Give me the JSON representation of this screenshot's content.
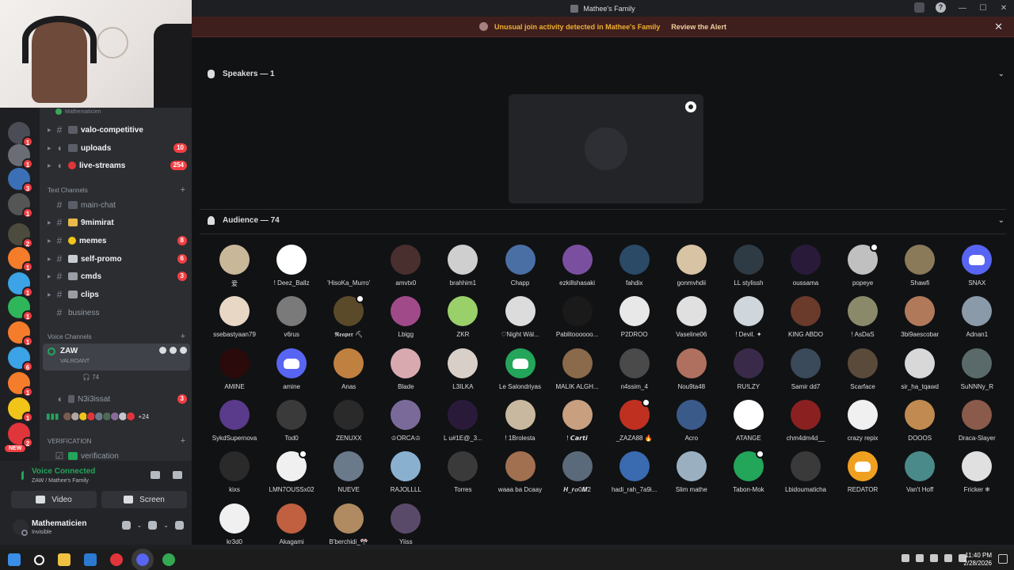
{
  "window": {
    "title": "Mathee's Family"
  },
  "alert": {
    "text": "Unusual join activity detected in Mathee's Family",
    "action": "Review the Alert"
  },
  "channel_top_label": "Mathematicien",
  "channels": [
    {
      "name": "valo-competitive",
      "count": "",
      "unread": true
    },
    {
      "name": "uploads",
      "count": "10",
      "unread": true
    },
    {
      "name": "live-streams",
      "count": "254",
      "unread": true
    }
  ],
  "text_category": "Text Channels",
  "text_channels": [
    {
      "name": "main-chat",
      "count": "",
      "unread": false
    },
    {
      "name": "9mimirat",
      "count": "",
      "unread": true
    },
    {
      "name": "memes",
      "count": "8",
      "unread": true
    },
    {
      "name": "self-promo",
      "count": "6",
      "unread": true
    },
    {
      "name": "cmds",
      "count": "3",
      "unread": true
    },
    {
      "name": "clips",
      "count": "",
      "unread": true
    },
    {
      "name": "business",
      "count": "",
      "unread": false
    }
  ],
  "voice_category": "Voice Channels",
  "active_voice": {
    "name": "ZAW",
    "sub": "VALROANT",
    "listeners": "74"
  },
  "n3i3issat": {
    "name": "N3i3issat",
    "count": "3"
  },
  "voice_avatars_more": "+24",
  "verification_category": "VERIFICATION",
  "verification_channel": "verification",
  "voice_panel": {
    "title": "Voice Connected",
    "sub": "ZAW / Mathee's Family",
    "video": "Video",
    "screen": "Screen"
  },
  "user": {
    "name": "Mathematicien",
    "status": "Invisible"
  },
  "speakers": {
    "label": "Speakers — 1"
  },
  "audience": {
    "label": "Audience — 74"
  },
  "audience_members": [
    "爱",
    "! Deez_Ballz",
    "'HisoKa_Murro'",
    "amvtx0",
    "brahhim1",
    "Chapp",
    "ezkillshasaki",
    "fahdix",
    "gonmvhdii",
    "LL stylissh",
    "oussama",
    "popeye",
    "Shawfi",
    "SNAX",
    "ssebastyaan79",
    "v6rus",
    "𝕽𝖊𝖆𝖕𝖊𝖗 ⛏",
    "Lbigg",
    "ZKR",
    "♡Night Wäl...",
    "Pablitoooooo...",
    "P2DROO",
    "Vaseline06",
    "! Devil. ✦",
    "KING ABDO",
    "! AsDaS",
    "3bi9aescobar",
    "Adnan1",
    "AMINE",
    "amine",
    "Anas",
    "Blade",
    "L3ILKA",
    "Le Salondriyas",
    "MALIK ALGH...",
    "n4ssim_4",
    "Nou9ta48",
    "RU!LZY",
    "Samir dd7",
    "Scarface",
    "sir_ha_tqawd",
    "SuNNNy_R",
    "SykdSupernova",
    "Tod0",
    "ZENUXX",
    "♔ORCA♔",
    "L u#1E@_3...",
    "! 1Brolesta",
    "! 𝘾𝙖𝙧𝙩𝙞",
    "_ZAZA88 🔥",
    "Acro",
    "ATANGE",
    "chm4dm4d__",
    "crazy repix",
    "DOOOS",
    "Draca-Slayer",
    "kixs",
    "LMN7OUSSx02",
    "NUEVE",
    "RAJOLLLL",
    "Torres",
    "waaa ba Dcaay",
    "𝑯_𝒓𝒐0𝑴2",
    "hadi_rah_7a9i...",
    "Slim mathe",
    "Tabon-Mok",
    "Lbidoumaticha",
    "REDATOR",
    "Van't Hoff",
    "Fricker ❄",
    "kr3d0",
    "Akagami",
    "B'berchidi_🎌",
    "Yiiss"
  ],
  "taskbar": {
    "time": "11:40 PM",
    "date": "2/28/2026"
  },
  "colors": {
    "accent": "#5865f2",
    "danger": "#f23f43",
    "online": "#23a55a",
    "alert_bg": "#3e1f1d",
    "alert_text": "#f0b132"
  }
}
